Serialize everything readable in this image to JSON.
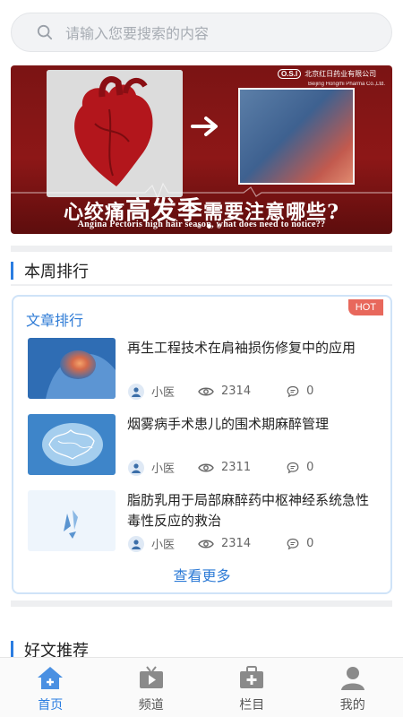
{
  "search": {
    "placeholder": "请输入您要搜索的内容",
    "icon": "search-icon"
  },
  "banner": {
    "logo_mark": "O.S.I",
    "logo_cn": "北京红日药业有限公司",
    "logo_en": "Beijing Hongrhi Pharma Co.,Ltd.",
    "headline_a": "心绞痛",
    "headline_b": "高发季",
    "headline_c": "需要注意哪些?",
    "subline": "Angina Pectoris high hair season, what does need to notice??",
    "slide_count": 3,
    "active_slide": 1
  },
  "weekly": {
    "title": "本周排行",
    "card_title": "文章排行",
    "badge": "HOT",
    "articles": [
      {
        "title": "再生工程技术在肩袖损伤修复中的应用",
        "author": "小医",
        "views": "2314",
        "comments": "0"
      },
      {
        "title": "烟雾病手术患儿的围术期麻醉管理",
        "author": "小医",
        "views": "2311",
        "comments": "0"
      },
      {
        "title": "脂肪乳用于局部麻醉药中枢神经系统急性毒性反应的救治",
        "author": "小医",
        "views": "2314",
        "comments": "0"
      }
    ],
    "more": "查看更多"
  },
  "recommend": {
    "title": "好文推荐"
  },
  "tabbar": {
    "items": [
      {
        "label": "首页",
        "icon": "home-icon",
        "active": true
      },
      {
        "label": "频道",
        "icon": "tv-icon",
        "active": false
      },
      {
        "label": "栏目",
        "icon": "medical-kit-icon",
        "active": false
      },
      {
        "label": "我的",
        "icon": "user-icon",
        "active": false
      }
    ]
  },
  "colors": {
    "accent": "#2b7de1",
    "hot_badge": "#e8685c",
    "banner_bg": "#8d1717"
  }
}
